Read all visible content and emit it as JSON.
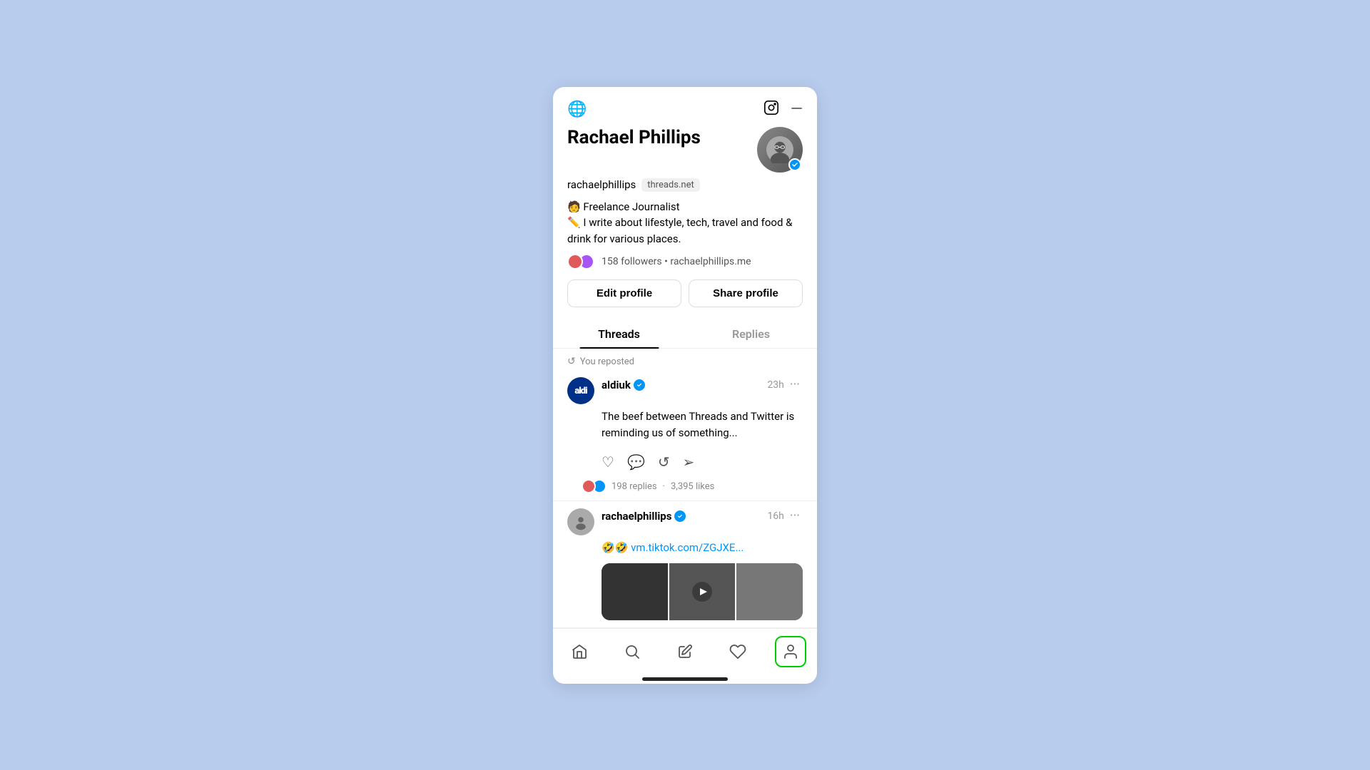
{
  "app": {
    "title": "Threads Profile"
  },
  "header": {
    "globe_icon": "🌐",
    "instagram_icon": "📷",
    "menu_icon": "—"
  },
  "profile": {
    "name": "Rachael Phillips",
    "username": "rachaelphillips",
    "platform_badge": "threads.net",
    "bio_line1": "🧑 Freelance Journalist",
    "bio_line2": "✏️ I write about lifestyle, tech, travel and food & drink for various places.",
    "followers_count": "158 followers",
    "followers_separator": "•",
    "website": "rachaelphillips.me",
    "edit_button": "Edit profile",
    "share_button": "Share profile"
  },
  "tabs": {
    "threads_label": "Threads",
    "replies_label": "Replies"
  },
  "posts": [
    {
      "repost_label": "You reposted",
      "author": "aldiuk",
      "verified": true,
      "time": "23h",
      "content": "The beef between Threads and Twitter is reminding us of something...",
      "replies": "198 replies",
      "likes": "3,395 likes",
      "separator": "·"
    },
    {
      "author": "rachaelphillips",
      "verified": true,
      "time": "16h",
      "content": "🤣🤣 vm.tiktok.com/ZGJXE...",
      "link": "vm.tiktok.com/ZGJXE..."
    }
  ],
  "bottom_nav": {
    "home_icon": "home",
    "search_icon": "search",
    "compose_icon": "compose",
    "heart_icon": "heart",
    "profile_icon": "profile"
  }
}
